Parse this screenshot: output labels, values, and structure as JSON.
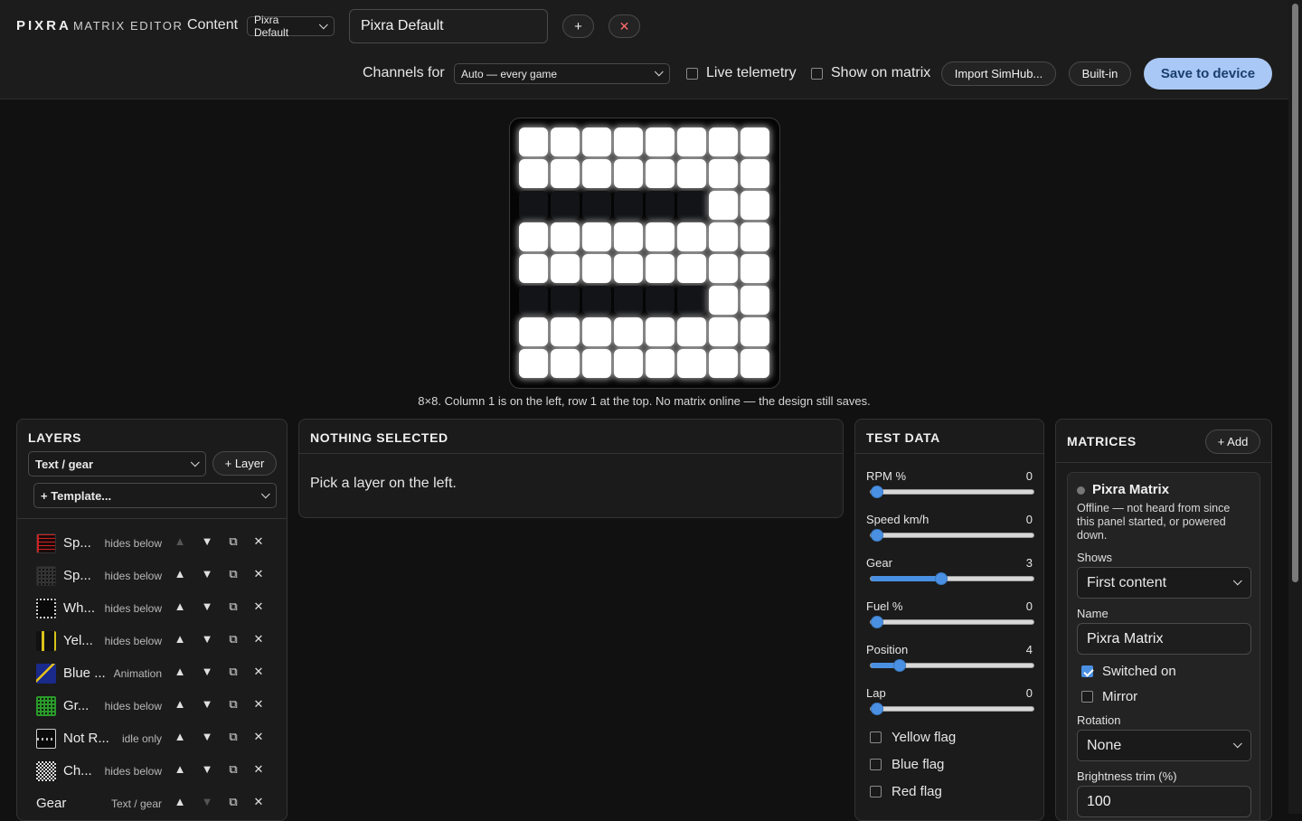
{
  "app": {
    "brand": "PIXRA",
    "subtitle": "MATRIX EDITOR"
  },
  "header": {
    "content_label": "Content",
    "content_select": "Pixra Default",
    "content_name": "Pixra Default",
    "add_symbol": "+",
    "close_symbol": "✕",
    "channels_label": "Channels for",
    "channels_select": "Auto — every game",
    "live_telemetry": "Live telemetry",
    "live_telemetry_checked": false,
    "show_on_matrix": "Show on matrix",
    "show_on_matrix_checked": false,
    "import_button": "Import SimHub...",
    "builtin_button": "Built-in",
    "save_button": "Save to device"
  },
  "matrix": {
    "caption": "8×8. Column 1 is on the left, row 1 at the top. No matrix online — the design still saves.",
    "rows": [
      [
        1,
        1,
        1,
        1,
        1,
        1,
        1,
        1
      ],
      [
        1,
        1,
        1,
        1,
        1,
        1,
        1,
        1
      ],
      [
        0,
        0,
        0,
        0,
        0,
        0,
        1,
        1
      ],
      [
        1,
        1,
        1,
        1,
        1,
        1,
        1,
        1
      ],
      [
        1,
        1,
        1,
        1,
        1,
        1,
        1,
        1
      ],
      [
        0,
        0,
        0,
        0,
        0,
        0,
        1,
        1
      ],
      [
        1,
        1,
        1,
        1,
        1,
        1,
        1,
        1
      ],
      [
        1,
        1,
        1,
        1,
        1,
        1,
        1,
        1
      ]
    ],
    "on_color": "#ffffff",
    "off_color": "#121418"
  },
  "layers": {
    "title": "LAYERS",
    "type_select": "Text / gear",
    "add_layer": "+ Layer",
    "template_select": "+ Template...",
    "items": [
      {
        "name": "Sp...",
        "tag": "hides below",
        "icon": "red-grid-thumb",
        "up_enabled": false,
        "down_enabled": true
      },
      {
        "name": "Sp...",
        "tag": "hides below",
        "icon": "dark-grid-thumb",
        "up_enabled": true,
        "down_enabled": true
      },
      {
        "name": "Wh...",
        "tag": "hides below",
        "icon": "white-border-thumb",
        "up_enabled": true,
        "down_enabled": true
      },
      {
        "name": "Yel...",
        "tag": "hides below",
        "icon": "yellow-columns-thumb",
        "up_enabled": true,
        "down_enabled": true
      },
      {
        "name": "Blue ...",
        "tag": "Animation",
        "icon": "blue-animation-thumb",
        "up_enabled": true,
        "down_enabled": true
      },
      {
        "name": "Gr...",
        "tag": "hides below",
        "icon": "green-grid-thumb",
        "up_enabled": true,
        "down_enabled": true
      },
      {
        "name": "Not R...",
        "tag": "idle only",
        "icon": "white-pattern-thumb",
        "up_enabled": true,
        "down_enabled": true
      },
      {
        "name": "Ch...",
        "tag": "hides below",
        "icon": "checker-thumb",
        "up_enabled": true,
        "down_enabled": true
      },
      {
        "name": "Gear",
        "tag": "Text / gear",
        "icon": "",
        "up_enabled": true,
        "down_enabled": false
      }
    ],
    "symbols": {
      "up": "▲",
      "down": "▼",
      "dup": "⧉",
      "del": "✕"
    }
  },
  "selection": {
    "title": "NOTHING SELECTED",
    "hint": "Pick a layer on the left."
  },
  "test_data": {
    "title": "TEST DATA",
    "sliders": [
      {
        "label": "RPM %",
        "value": "0",
        "fraction": 0.0
      },
      {
        "label": "Speed km/h",
        "value": "0",
        "fraction": 0.0
      },
      {
        "label": "Gear",
        "value": "3",
        "fraction": 0.43
      },
      {
        "label": "Fuel %",
        "value": "0",
        "fraction": 0.0
      },
      {
        "label": "Position",
        "value": "4",
        "fraction": 0.15
      },
      {
        "label": "Lap",
        "value": "0",
        "fraction": 0.0
      }
    ],
    "flags": [
      {
        "label": "Yellow flag",
        "checked": false
      },
      {
        "label": "Blue flag",
        "checked": false
      },
      {
        "label": "Red flag",
        "checked": false
      }
    ]
  },
  "matrices": {
    "title": "MATRICES",
    "add_button": "+ Add",
    "device": {
      "name": "Pixra Matrix",
      "status": "Offline — not heard from since this panel started, or powered down.",
      "shows_label": "Shows",
      "shows_value": "First content",
      "name_label": "Name",
      "name_value": "Pixra Matrix",
      "switched_on": "Switched on",
      "switched_on_checked": true,
      "mirror": "Mirror",
      "mirror_checked": false,
      "rotation_label": "Rotation",
      "rotation_value": "None",
      "brightness_label": "Brightness trim (%)",
      "brightness_value": "100"
    }
  },
  "colors": {
    "accent": "#4a90e2",
    "save_button_bg": "#a9c8f5",
    "save_button_text": "#1a3e6e",
    "panel_bg": "#1b1b1b",
    "page_bg": "#111111"
  }
}
